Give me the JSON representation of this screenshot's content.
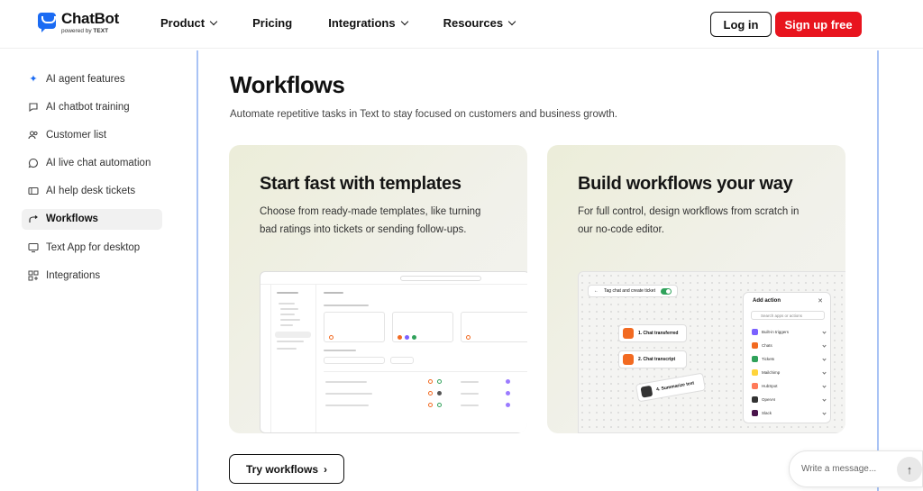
{
  "brand": {
    "name": "ChatBot",
    "powered_by": "powered by",
    "powered_brand": "TEXT"
  },
  "nav": {
    "items": [
      {
        "label": "Product",
        "has_dropdown": true
      },
      {
        "label": "Pricing",
        "has_dropdown": false
      },
      {
        "label": "Integrations",
        "has_dropdown": true
      },
      {
        "label": "Resources",
        "has_dropdown": true
      }
    ],
    "login": "Log in",
    "signup": "Sign up free"
  },
  "sidebar": {
    "items": [
      {
        "label": "AI agent features",
        "icon": "sparkle-icon"
      },
      {
        "label": "AI chatbot training",
        "icon": "chat-bubble-icon"
      },
      {
        "label": "Customer list",
        "icon": "users-icon"
      },
      {
        "label": "AI live chat automation",
        "icon": "chat-circle-icon"
      },
      {
        "label": "AI help desk tickets",
        "icon": "ticket-icon"
      },
      {
        "label": "Workflows",
        "icon": "workflow-icon",
        "active": true
      },
      {
        "label": "Text App for desktop",
        "icon": "monitor-icon"
      },
      {
        "label": "Integrations",
        "icon": "grid-plus-icon"
      }
    ]
  },
  "main": {
    "title": "Workflows",
    "subtitle": "Automate repetitive tasks in Text to stay focused on customers and business growth.",
    "cards": [
      {
        "title": "Start fast with templates",
        "description": "Choose from ready-made templates, like turning bad ratings into tickets or sending follow-ups."
      },
      {
        "title": "Build workflows your way",
        "description": "For full control, design workflows from scratch in our no-code editor."
      }
    ],
    "builder": {
      "flow_name": "Tag chat and create ticket",
      "nodes": [
        "1. Chat transferred",
        "2. Chat transcript",
        "4. Summarize text"
      ],
      "add_action": {
        "title": "Add action",
        "search_placeholder": "Search apps or actions",
        "rows": [
          {
            "label": "Built-in triggers",
            "color": "#7b61ff"
          },
          {
            "label": "Chats",
            "color": "#f26a21"
          },
          {
            "label": "Tickets",
            "color": "#2fa15a"
          },
          {
            "label": "Mailchimp",
            "color": "#ffd43b"
          },
          {
            "label": "HubSpot",
            "color": "#ff7a59"
          },
          {
            "label": "OpenAI",
            "color": "#333333"
          },
          {
            "label": "Slack",
            "color": "#4a154b"
          }
        ]
      }
    },
    "cta": "Try workflows"
  },
  "chat_widget": {
    "placeholder": "Write a message..."
  },
  "colors": {
    "accent_red": "#e8141e",
    "brand_blue": "#1b6bf3",
    "panel_border": "#a9c3f5"
  }
}
